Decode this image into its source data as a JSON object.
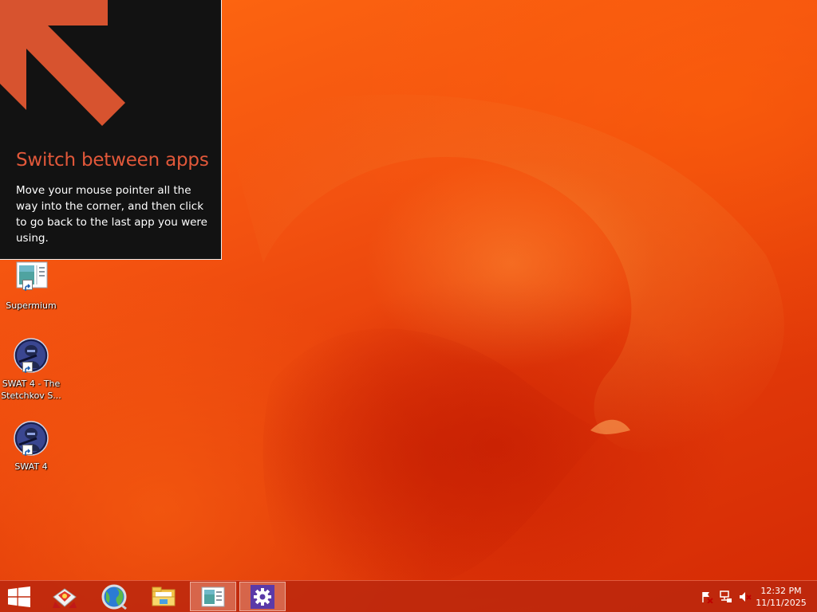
{
  "tip": {
    "title": "Switch between apps",
    "body": "Move your mouse pointer all the way into the corner, and then click to go back to the last app you were using."
  },
  "desktop_icons": [
    {
      "label": "Supermium",
      "icon": "supermium-icon"
    },
    {
      "label": "SWAT 4 - The Stetchkov S...",
      "icon": "swat4-icon"
    },
    {
      "label": "SWAT 4",
      "icon": "swat4-icon"
    }
  ],
  "taskbar": {
    "items": [
      {
        "name": "start-button",
        "icon": "windows-logo-icon"
      },
      {
        "name": "taskbar-app-paint",
        "icon": "paint-icon"
      },
      {
        "name": "taskbar-app-browser",
        "icon": "browser-globe-icon"
      },
      {
        "name": "taskbar-app-file-explorer",
        "icon": "folder-icon"
      },
      {
        "name": "taskbar-app-supermium",
        "icon": "supermium-icon",
        "active": true
      },
      {
        "name": "taskbar-app-settings",
        "icon": "gear-icon",
        "active": true
      }
    ],
    "tray": {
      "icons": [
        "action-center-flag-icon",
        "network-icon",
        "volume-muted-icon"
      ],
      "time": "12:32 PM",
      "date": "11/11/2025"
    }
  },
  "colors": {
    "tip_background": "#121212",
    "tip_title": "#e2583a",
    "tip_arrow": "#d7532f",
    "wallpaper": "#f35210",
    "taskbar": "#bc280e"
  }
}
